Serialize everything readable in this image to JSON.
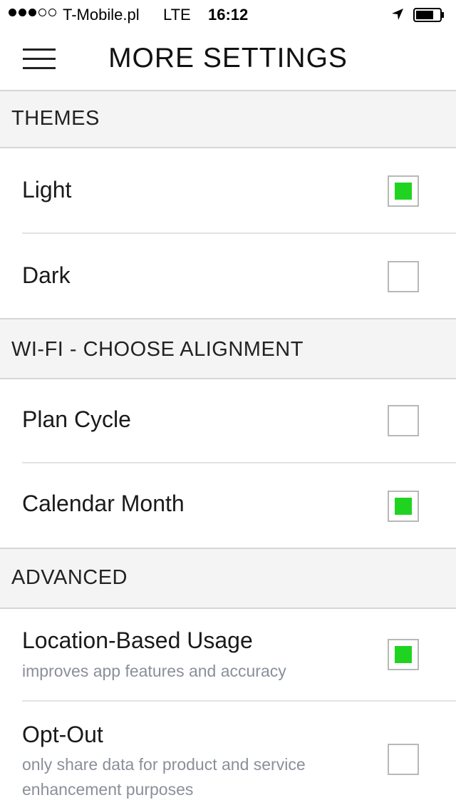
{
  "status_bar": {
    "signal_dots_filled": 3,
    "signal_dots_total": 5,
    "carrier": "T-Mobile.pl",
    "network": "LTE",
    "time": "16:12",
    "location_icon": "location-arrow-icon",
    "battery_icon": "battery-icon"
  },
  "nav": {
    "title": "MORE SETTINGS",
    "menu_icon": "hamburger-menu-icon"
  },
  "sections": {
    "themes": {
      "header": "THEMES",
      "options": [
        {
          "label": "Light",
          "checked": true
        },
        {
          "label": "Dark",
          "checked": false
        }
      ]
    },
    "wifi": {
      "header": "WI-FI - CHOOSE ALIGNMENT",
      "options": [
        {
          "label": "Plan Cycle",
          "checked": false
        },
        {
          "label": "Calendar Month",
          "checked": true
        }
      ]
    },
    "advanced": {
      "header": "ADVANCED",
      "options": [
        {
          "label": "Location-Based Usage",
          "sublabel": "improves app features and accuracy",
          "checked": true
        },
        {
          "label": "Opt-Out",
          "sublabel": "only share data for product and service enhancement purposes",
          "checked": false
        }
      ]
    }
  },
  "colors": {
    "checked_fill": "#21d321",
    "section_bg": "#f4f4f4",
    "sublabel": "#8a8f99"
  }
}
